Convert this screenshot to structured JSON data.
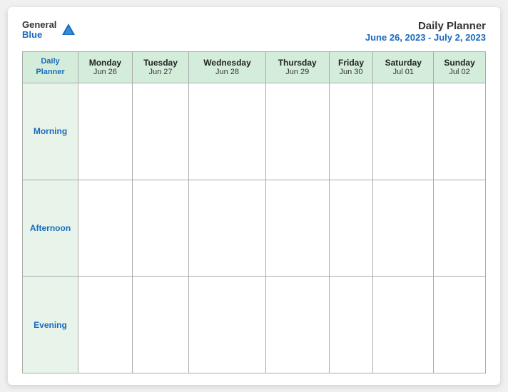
{
  "logo": {
    "general": "General",
    "blue": "Blue"
  },
  "title": {
    "main": "Daily Planner",
    "sub": "June 26, 2023 - July 2, 2023"
  },
  "headers": {
    "col0": {
      "name": "Daily",
      "name2": "Planner",
      "date": ""
    },
    "col1": {
      "name": "Monday",
      "date": "Jun 26"
    },
    "col2": {
      "name": "Tuesday",
      "date": "Jun 27"
    },
    "col3": {
      "name": "Wednesday",
      "date": "Jun 28"
    },
    "col4": {
      "name": "Thursday",
      "date": "Jun 29"
    },
    "col5": {
      "name": "Friday",
      "date": "Jun 30"
    },
    "col6": {
      "name": "Saturday",
      "date": "Jul 01"
    },
    "col7": {
      "name": "Sunday",
      "date": "Jul 02"
    }
  },
  "rows": {
    "morning": "Morning",
    "afternoon": "Afternoon",
    "evening": "Evening"
  }
}
